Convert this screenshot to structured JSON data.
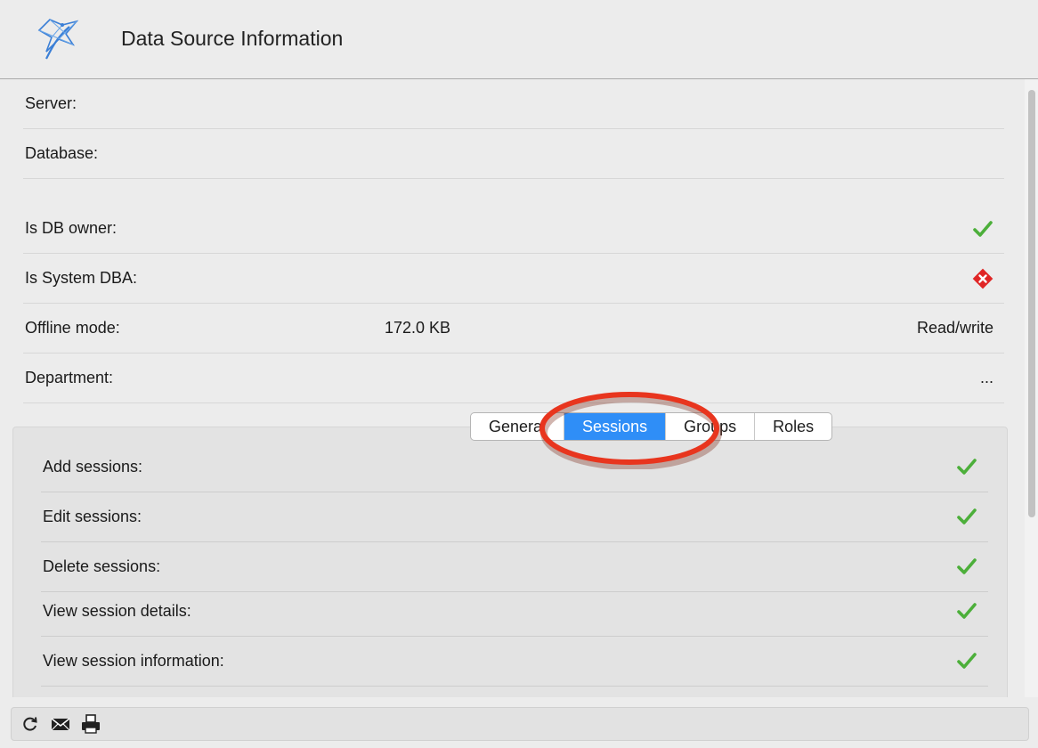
{
  "header": {
    "title": "Data Source Information",
    "logo_icon": "data-source-logo-icon"
  },
  "info_rows": [
    {
      "label": "Server:"
    },
    {
      "label": "Database:"
    },
    {
      "label": "Is DB owner:",
      "status": "check-icon"
    },
    {
      "label": "Is System DBA:",
      "status": "cross-icon"
    },
    {
      "label": "Offline mode:",
      "size": "172.0 KB",
      "access": "Read/write"
    },
    {
      "label": "Department:",
      "more": "..."
    }
  ],
  "tabs": [
    {
      "label": "General",
      "active": false
    },
    {
      "label": "Sessions",
      "active": true
    },
    {
      "label": "Groups",
      "active": false
    },
    {
      "label": "Roles",
      "active": false
    }
  ],
  "session_rows": [
    {
      "label": "Add sessions:",
      "status": "check-icon"
    },
    {
      "label": "Edit sessions:",
      "status": "check-icon"
    },
    {
      "label": "Delete sessions:",
      "status": "check-icon"
    },
    {
      "label": "View session details:",
      "status": "check-icon"
    },
    {
      "label": "View session information:",
      "status": "check-icon"
    }
  ],
  "toolbar": {
    "icons": [
      "refresh-icon",
      "email-icon",
      "print-icon"
    ]
  },
  "colors": {
    "accent": "#2f8ef7",
    "check": "#4caf3a",
    "cross": "#e02626",
    "highlight": "#e8351e"
  }
}
